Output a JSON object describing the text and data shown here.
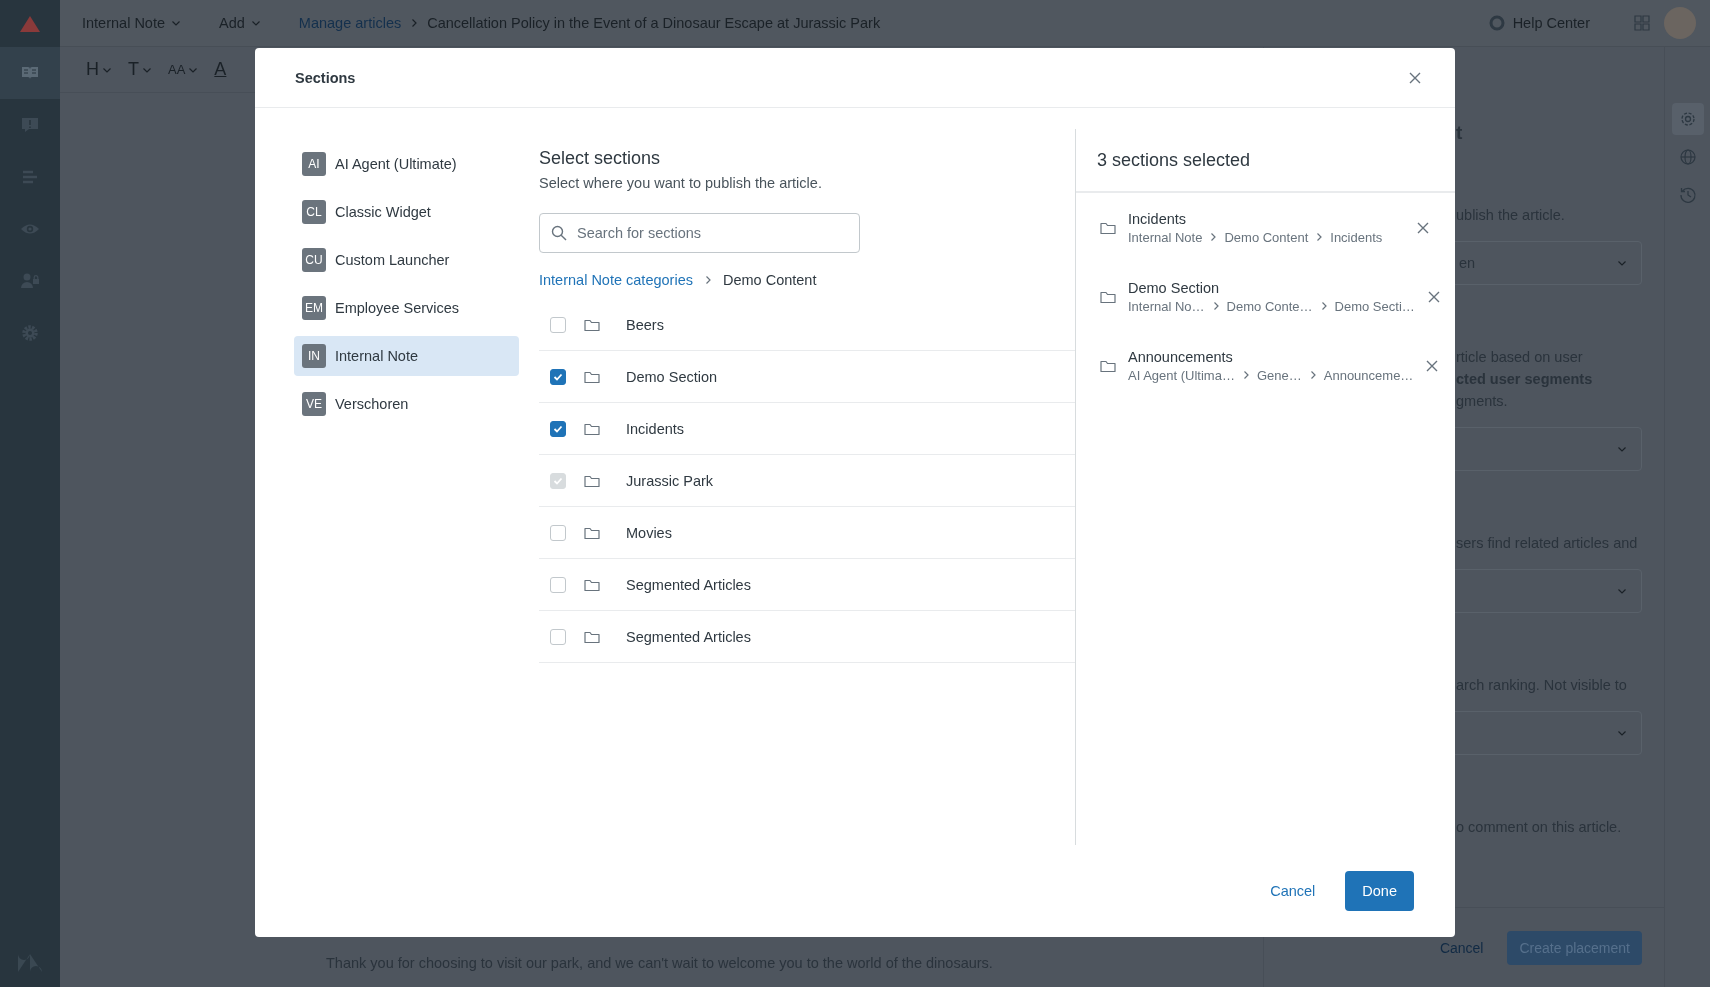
{
  "topbar": {
    "product_menu": "Internal Note",
    "add_menu": "Add",
    "breadcrumb_link": "Manage articles",
    "article_title": "Cancellation Policy in the Event of a Dinosaur Escape at Jurassic Park",
    "help_center": "Help Center"
  },
  "nav_rail": [
    {
      "kind": "book",
      "selected": true
    },
    {
      "kind": "alert",
      "selected": false
    },
    {
      "kind": "lines",
      "selected": false
    },
    {
      "kind": "eye",
      "selected": false
    },
    {
      "kind": "user-lock",
      "selected": false
    },
    {
      "kind": "gear",
      "selected": false
    }
  ],
  "editor_toolbar": [
    {
      "kind": "menu",
      "glyph": "H"
    },
    {
      "kind": "menu",
      "glyph": "T"
    },
    {
      "kind": "menu",
      "glyph": "AA"
    },
    {
      "kind": "color",
      "glyph": "A"
    }
  ],
  "article_body": "Thank you for choosing to visit our park, and we can't wait to welcome you to the world of the dinosaurs.",
  "settings_panel": {
    "items": [
      {
        "kind": "heading",
        "text": "t"
      },
      {
        "kind": "text",
        "text": "ublish the article."
      },
      {
        "kind": "dropdown",
        "value": "en"
      },
      {
        "kind": "text",
        "text": "rticle based on user"
      },
      {
        "kind": "label",
        "text": "cted user segments"
      },
      {
        "kind": "text",
        "text": "gments."
      },
      {
        "kind": "dropdown"
      },
      {
        "kind": "text",
        "text": "sers find related articles and"
      },
      {
        "kind": "dropdown"
      },
      {
        "kind": "text",
        "text": "arch ranking. Not visible to"
      },
      {
        "kind": "dropdown"
      },
      {
        "kind": "text",
        "text": "o comment on this article."
      }
    ],
    "cancel": "Cancel",
    "submit": "Create placement"
  },
  "side_strip": [
    {
      "kind": "settings",
      "selected": true
    },
    {
      "kind": "globe",
      "selected": false
    },
    {
      "kind": "history",
      "selected": false
    }
  ],
  "modal": {
    "title": "Sections",
    "brands": [
      {
        "initials": "AI",
        "label": "AI Agent (Ultimate)",
        "selected": false
      },
      {
        "initials": "CL",
        "label": "Classic Widget",
        "selected": false
      },
      {
        "initials": "CU",
        "label": "Custom Launcher",
        "selected": false
      },
      {
        "initials": "EM",
        "label": "Employee Services",
        "selected": false
      },
      {
        "initials": "IN",
        "label": "Internal Note",
        "selected": true
      },
      {
        "initials": "VE",
        "label": "Verschoren",
        "selected": false
      }
    ],
    "heading": "Select sections",
    "subheading": "Select where you want to publish the article.",
    "search": {
      "placeholder": "Search for sections"
    },
    "breadcrumb": {
      "link": "Internal Note categories",
      "current": "Demo Content"
    },
    "sections": [
      {
        "label": "Beers",
        "checked": false,
        "disabled": false
      },
      {
        "label": "Demo Section",
        "checked": true,
        "disabled": false
      },
      {
        "label": "Incidents",
        "checked": true,
        "disabled": false
      },
      {
        "label": "Jurassic Park",
        "checked": true,
        "disabled": true
      },
      {
        "label": "Movies",
        "checked": false,
        "disabled": false
      },
      {
        "label": "Segmented Articles",
        "checked": false,
        "disabled": false
      },
      {
        "label": "Segmented Articles",
        "checked": false,
        "disabled": false
      }
    ],
    "selected_panel": {
      "title": "3 sections selected",
      "items": [
        {
          "name": "Incidents",
          "path": [
            "Internal Note",
            "Demo Content",
            "Incidents"
          ]
        },
        {
          "name": "Demo Section",
          "path": [
            "Internal No…",
            "Demo Conte…",
            "Demo Secti…"
          ]
        },
        {
          "name": "Announcements",
          "path": [
            "AI Agent (Ultima…",
            "Gene…",
            "Announceme…"
          ]
        }
      ]
    },
    "cancel": "Cancel",
    "done": "Done"
  }
}
